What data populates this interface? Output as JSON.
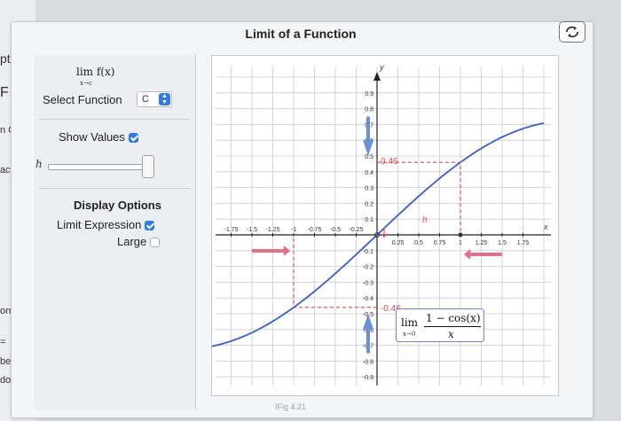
{
  "header": {
    "title": "Limit of a Function"
  },
  "left_page": {
    "fragments": [
      "pt",
      "F",
      "n C",
      "acti",
      "orrect",
      "=",
      "be an i",
      "does r"
    ]
  },
  "controls": {
    "limit_caption": "lim f(x)",
    "limit_sub": "x→c",
    "select_label": "Select Function",
    "select_value": "C",
    "show_values_label": "Show Values",
    "show_values_checked": true,
    "h_label": "h",
    "display_options_title": "Display Options",
    "limit_expression_label": "Limit Expression",
    "limit_expression_checked": true,
    "large_label": "Large",
    "large_checked": false
  },
  "expression": {
    "lim": "lim",
    "sub": "x→0",
    "numerator": "1 − cos(x)",
    "denominator": "x"
  },
  "footer": {
    "fig_label": "IFig 4.21"
  },
  "colors": {
    "curve": "#3a5fc4",
    "guide": "#d94a5a",
    "arrow_red": "#e0708a",
    "arrow_blue": "#6d8fd6",
    "check": "#2f7ce0"
  },
  "chart_data": {
    "type": "line",
    "x_axis_label": "x",
    "y_axis_label": "y",
    "x_ticks": [
      "-1.75",
      "-1.5",
      "-1.25",
      "-1",
      "-0.75",
      "-0.5",
      "-0.25",
      "0.25",
      "0.5",
      "0.75",
      "1",
      "1.25",
      "1.5",
      "1.75"
    ],
    "y_ticks_pos": [
      "0.1",
      "0.2",
      "0.3",
      "0.4",
      "0.5",
      "0.6",
      "0.7",
      "0.8",
      "0.9"
    ],
    "y_ticks_neg": [
      "-0.1",
      "-0.2",
      "-0.3",
      "-0.4",
      "-0.5",
      "-0.6",
      "-0.7",
      "-0.8",
      "-0.9"
    ],
    "xlim": [
      -2,
      2
    ],
    "ylim": [
      -1,
      1
    ],
    "grid": true,
    "function": "(1 - cos(x)) / x",
    "h": 1,
    "value_labels": [
      "0.46",
      "-0.46"
    ],
    "h_marker": "h",
    "samples": [
      {
        "x": -2,
        "y": -0.708
      },
      {
        "x": -1.75,
        "y": -0.671
      },
      {
        "x": -1.5,
        "y": -0.62
      },
      {
        "x": -1.25,
        "y": -0.548
      },
      {
        "x": -1,
        "y": -0.46
      },
      {
        "x": -0.75,
        "y": -0.358
      },
      {
        "x": -0.5,
        "y": -0.245
      },
      {
        "x": -0.25,
        "y": -0.124
      },
      {
        "x": 0,
        "y": 0
      },
      {
        "x": 0.25,
        "y": 0.124
      },
      {
        "x": 0.5,
        "y": 0.245
      },
      {
        "x": 0.75,
        "y": 0.358
      },
      {
        "x": 1,
        "y": 0.46
      },
      {
        "x": 1.25,
        "y": 0.548
      },
      {
        "x": 1.5,
        "y": 0.62
      },
      {
        "x": 1.75,
        "y": 0.671
      },
      {
        "x": 2,
        "y": 0.708
      }
    ]
  }
}
